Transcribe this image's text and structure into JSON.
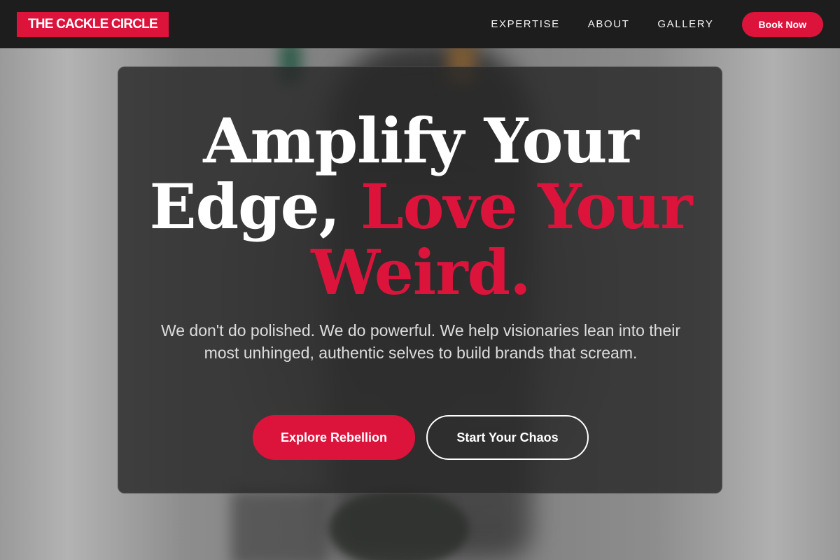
{
  "brand": {
    "logo_text": "THE CACKLE CIRCLE",
    "accent_color": "#dc143c"
  },
  "nav": {
    "links": [
      {
        "label": "EXPERTISE"
      },
      {
        "label": "ABOUT"
      },
      {
        "label": "GALLERY"
      }
    ],
    "cta_label": "Book Now"
  },
  "hero": {
    "headline": {
      "line1": "Amplify Your",
      "line2_white": "Edge, ",
      "line2_accent": "Love Your",
      "line3_accent": "Weird."
    },
    "subtitle": "We don't do polished. We do powerful. We help visionaries lean into their most unhinged, authentic selves to build brands that scream.",
    "primary_button": "Explore Rebellion",
    "secondary_button": "Start Your Chaos"
  }
}
